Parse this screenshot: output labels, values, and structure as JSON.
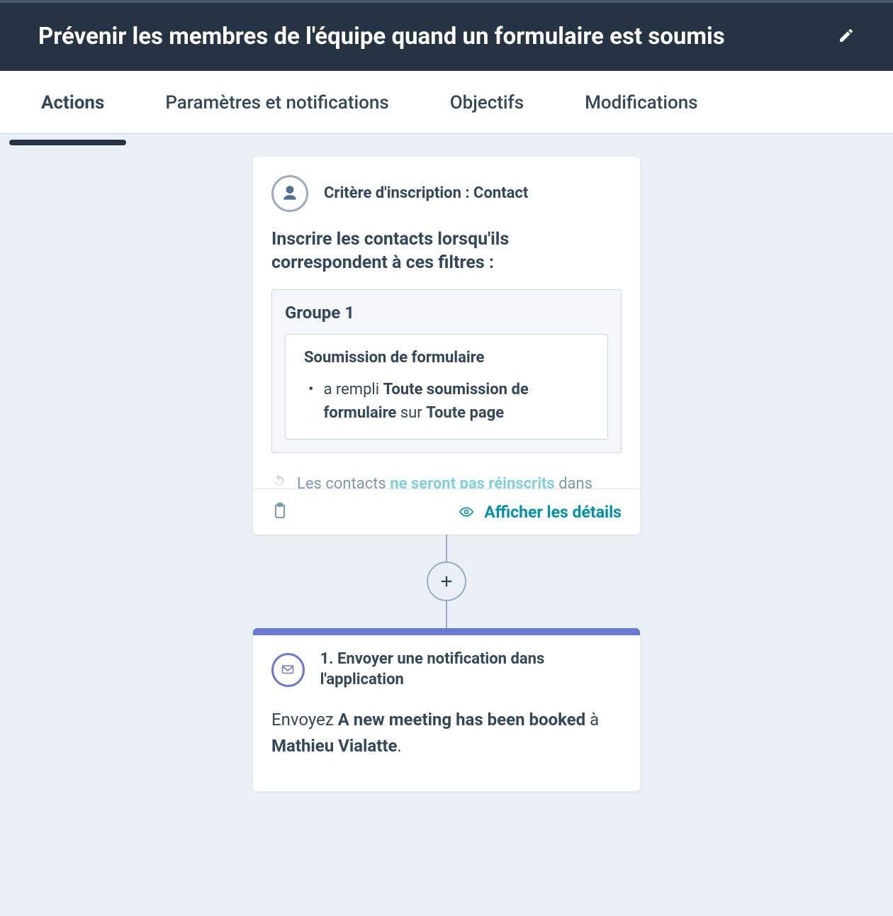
{
  "header": {
    "title": "Prévenir les membres de l'équipe quand un formulaire est soumis"
  },
  "tabs": {
    "actions": "Actions",
    "settings": "Paramètres et notifications",
    "objectives": "Objectifs",
    "modifications": "Modifications"
  },
  "trigger": {
    "criteria_label": "Critère d'inscription : Contact",
    "enroll_desc": "Inscrire les contacts lorsqu'ils correspondent à ces filtres :",
    "group_label": "Groupe 1",
    "filter_title": "Soumission de formulaire",
    "filter_prefix": "a rempli ",
    "filter_bold1": "Toute soumission de formulaire",
    "filter_mid": " sur ",
    "filter_bold2": "Toute page",
    "reenroll_pre": "Les contacts ",
    "reenroll_hi": "ne seront pas réinscrits",
    "reenroll_post": " dans",
    "details_label": "Afficher les détails"
  },
  "step": {
    "title": "1. Envoyer une notification dans l'application",
    "body_pre": "Envoyez ",
    "body_bold1": "A new meeting has been booked",
    "body_mid": " à ",
    "body_bold2": "Mathieu Vialatte",
    "body_post": "."
  }
}
